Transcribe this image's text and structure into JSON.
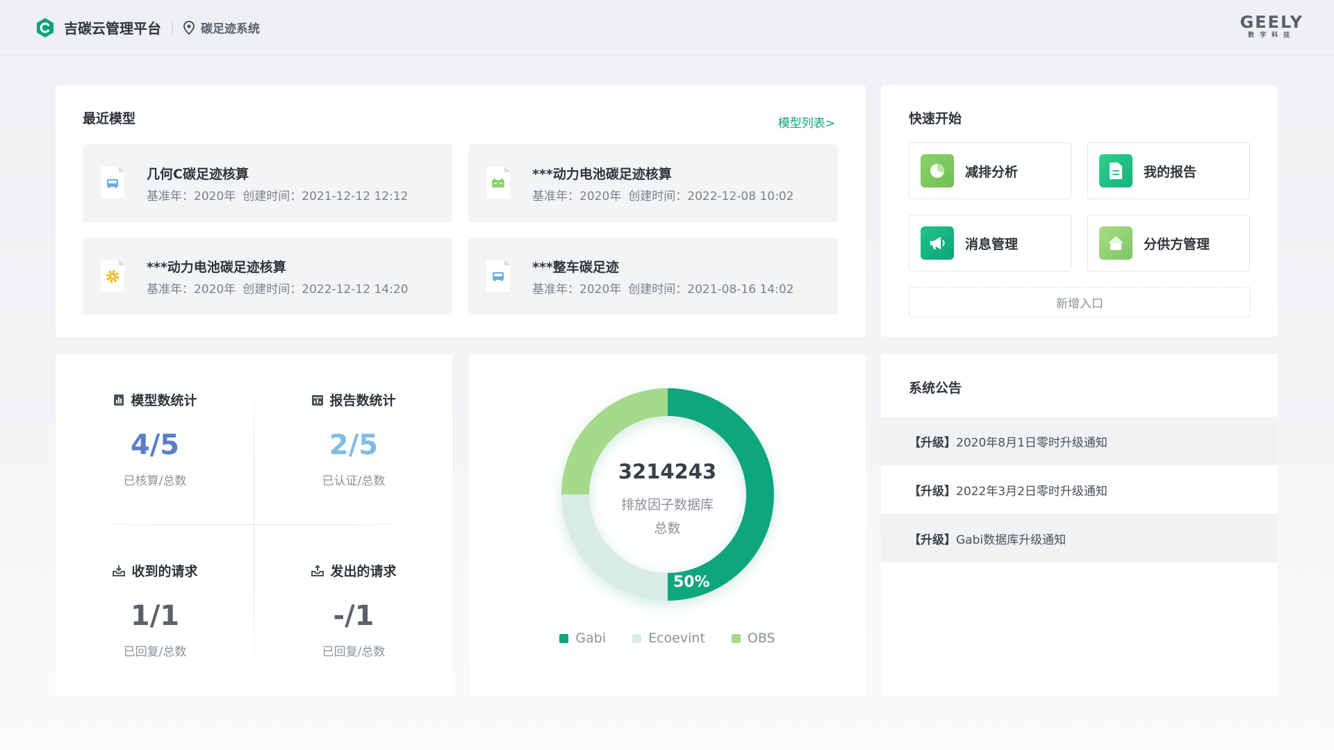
{
  "header": {
    "app_title": "吉碳云管理平台",
    "sub_title": "碳足迹系统",
    "brand_name": "GEELY",
    "brand_sub": "数字科技"
  },
  "recent_models": {
    "title": "最近模型",
    "list_link": "模型列表>",
    "items": [
      {
        "name": "几何C碳足迹核算",
        "base_year": "基准年：2020年",
        "created": "创建时间：2021-12-12  12:12",
        "icon": "car-icon",
        "color": "#6aa9e6"
      },
      {
        "name": "***动力电池碳足迹核算",
        "base_year": "基准年：2020年",
        "created": "创建时间：2022-12-08  10:02",
        "icon": "battery-icon",
        "color": "#8fd16b"
      },
      {
        "name": "***动力电池碳足迹核算",
        "base_year": "基准年：2020年",
        "created": "创建时间：2022-12-12  14:20",
        "icon": "gear-icon",
        "color": "#f4b81e"
      },
      {
        "name": "***整车碳足迹",
        "base_year": "基准年：2020年",
        "created": "创建时间：2021-08-16  14:02",
        "icon": "car-icon",
        "color": "#6aa9e6"
      }
    ]
  },
  "quick_start": {
    "title": "快速开始",
    "buttons": [
      {
        "label": "减排分析",
        "icon": "pie-chart-icon"
      },
      {
        "label": "我的报告",
        "icon": "report-doc-icon"
      },
      {
        "label": "消息管理",
        "icon": "megaphone-icon"
      },
      {
        "label": "分供方管理",
        "icon": "home-icon"
      }
    ],
    "add_entry": "新增入口"
  },
  "stats": [
    {
      "title": "模型数统计",
      "value": "4/5",
      "label": "已核算/总数",
      "color": "#5b7fc7",
      "icon": "bar-chart-icon"
    },
    {
      "title": "报告数统计",
      "value": "2/5",
      "label": "已认证/总数",
      "color": "#7fbde6",
      "icon": "calendar-chart-icon"
    },
    {
      "title": "收到的请求",
      "value": "1/1",
      "label": "已回复/总数",
      "color": "#5c6169",
      "icon": "inbox-in-icon"
    },
    {
      "title": "发出的请求",
      "value": "-/1",
      "label": "已回复/总数",
      "color": "#5c6169",
      "icon": "inbox-out-icon"
    }
  ],
  "chart_data": {
    "type": "pie",
    "total": "3214243",
    "center_label_1": "排放因子数据库",
    "center_label_2": "总数",
    "data_label": "50%",
    "series": [
      {
        "name": "Gabi",
        "value": 50,
        "color": "#0fa67e"
      },
      {
        "name": "Ecoevint",
        "value": 25,
        "color": "#d8ebe6"
      },
      {
        "name": "OBS",
        "value": 25,
        "color": "#a6d98a"
      }
    ]
  },
  "notices": {
    "title": "系统公告",
    "items": [
      {
        "tag": "【升级】",
        "text": "2020年8月1日零时升级通知"
      },
      {
        "tag": "【升级】",
        "text": "2022年3月2日零时升级通知"
      },
      {
        "tag": "【升级】",
        "text": "Gabi数据库升级通知"
      }
    ]
  }
}
